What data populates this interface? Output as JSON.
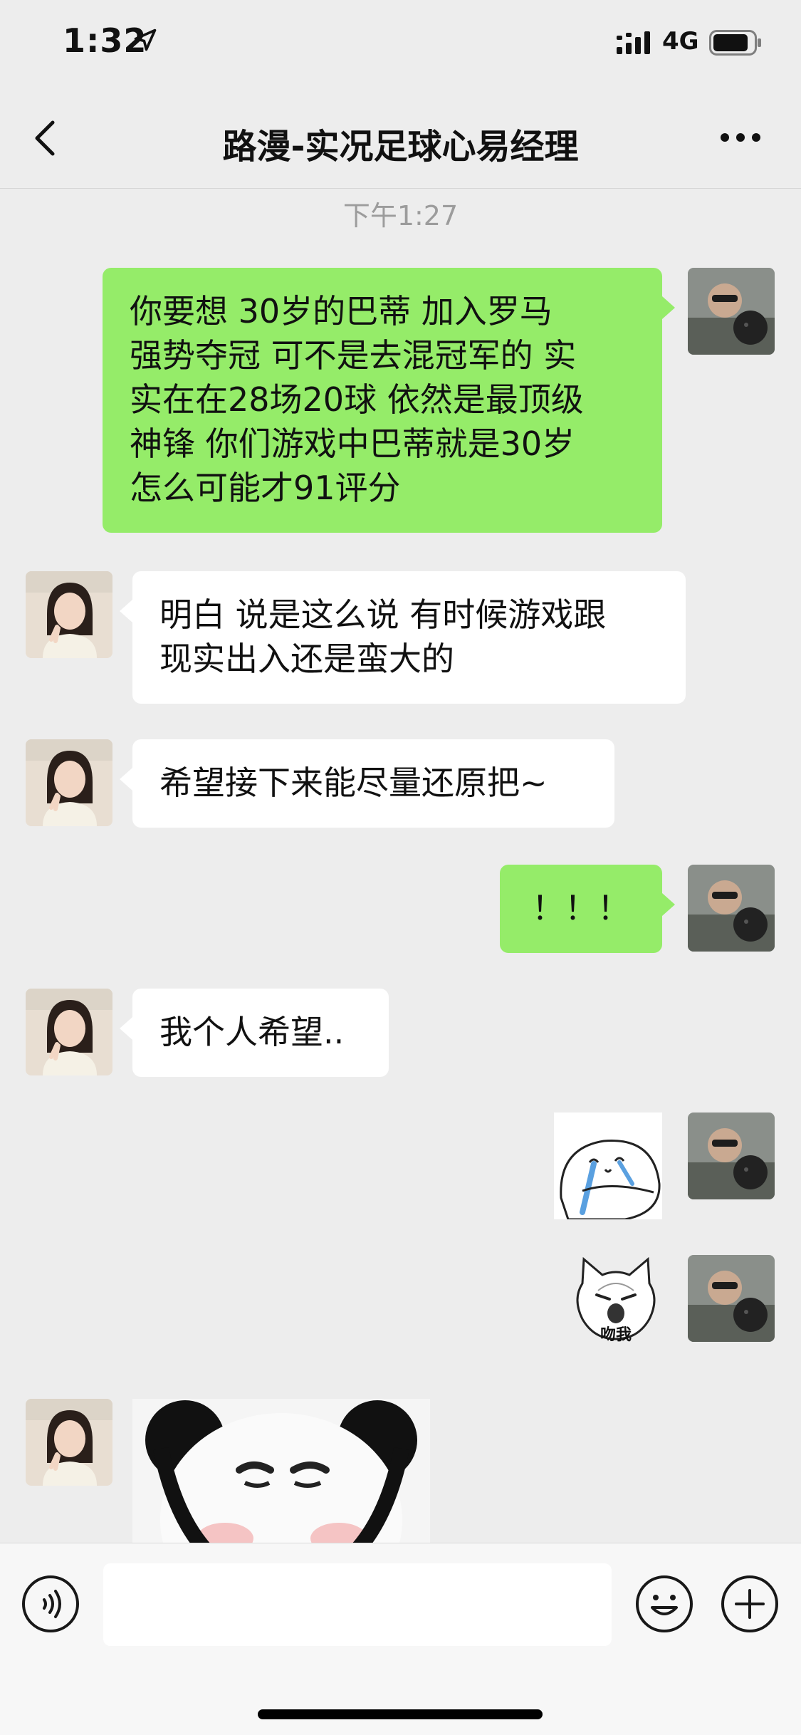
{
  "status_bar": {
    "time": "1:32",
    "network": "4G",
    "location_icon": "location-arrow-icon",
    "signal_icon": "signal-bars-icon",
    "battery_icon": "battery-icon"
  },
  "header": {
    "title": "路漫-实况足球心易经理",
    "back_icon": "back-chevron-icon",
    "more_icon": "more-dots-icon"
  },
  "chat": {
    "timestamp": "下午1:27",
    "messages": [
      {
        "sender": "me",
        "type": "text",
        "text": "你要想 30岁的巴蒂 加入罗马\n强势夺冠 可不是去混冠军的 实\n实在在28场20球 依然是最顶级\n神锋 你们游戏中巴蒂就是30岁\n怎么可能才91评分"
      },
      {
        "sender": "them",
        "type": "text",
        "text": "明白 说是这么说 有时候游戏跟\n现实出入还是蛮大的"
      },
      {
        "sender": "them",
        "type": "text",
        "text": "希望接下来能尽量还原把~"
      },
      {
        "sender": "me",
        "type": "text",
        "text": "！！！"
      },
      {
        "sender": "them",
        "type": "text",
        "text": "我个人希望.."
      },
      {
        "sender": "me",
        "type": "sticker",
        "sticker": "crying-bun-sticker"
      },
      {
        "sender": "me",
        "type": "sticker",
        "sticker": "cat-face-sticker",
        "caption": "吻我"
      },
      {
        "sender": "them",
        "type": "sticker",
        "sticker": "panda-face-sticker"
      }
    ]
  },
  "input_bar": {
    "voice_icon": "voice-icon",
    "emoji_icon": "emoji-icon",
    "plus_icon": "plus-icon",
    "text_value": ""
  },
  "colors": {
    "my_bubble": "#95ec69",
    "their_bubble": "#ffffff",
    "background": "#ededed"
  }
}
